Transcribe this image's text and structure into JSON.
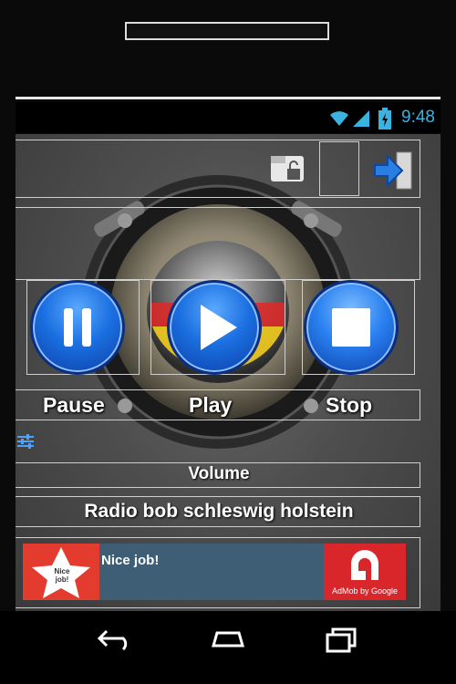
{
  "status_bar": {
    "time": "9:48",
    "accent_color": "#3bb3e0"
  },
  "controls": {
    "pause_label": "Pause",
    "play_label": "Play",
    "stop_label": "Stop",
    "volume_label": "Volume"
  },
  "station": {
    "name": "Radio bob schleswig holstein"
  },
  "ad": {
    "message": "Nice job!",
    "badge_text": "Nice job!",
    "provider": "AdMob by Google"
  },
  "icons": {
    "lock": "unlock-icon",
    "exit": "exit-icon",
    "equalizer": "equalizer-icon"
  },
  "colors": {
    "button_blue": "#1b6fe0",
    "ad_bg": "#3d5e74",
    "admob_red": "#d9262b"
  }
}
